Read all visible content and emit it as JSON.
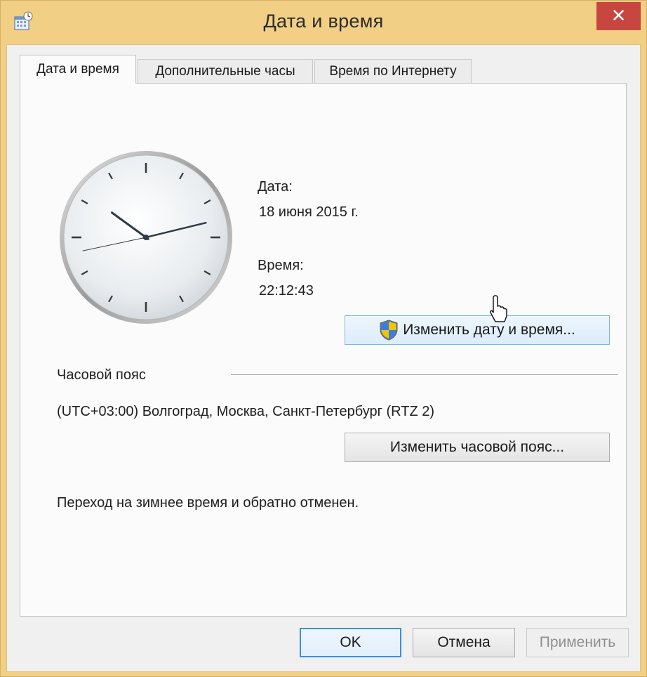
{
  "window": {
    "title": "Дата и время",
    "title_icon": "calendar-clock-icon",
    "close_icon": "close-icon",
    "close_glyph": "✕",
    "close_color": "#c7463f",
    "frame_color": "#f1cf85"
  },
  "tabs": [
    {
      "label": "Дата и время",
      "active": true
    },
    {
      "label": "Дополнительные часы",
      "active": false
    },
    {
      "label": "Время по Интернету",
      "active": false
    }
  ],
  "date_time": {
    "clock_icon": "analog-clock-icon",
    "date_label": "Дата:",
    "date_value": "18 июня 2015 г.",
    "time_label": "Время:",
    "time_value": "22:12:43",
    "change_button": "Изменить дату и время...",
    "change_button_icon": "uac-shield-icon"
  },
  "timezone": {
    "section_label": "Часовой пояс",
    "value": "(UTC+03:00) Волгоград, Москва, Санкт-Петербург (RTZ 2)",
    "change_button": "Изменить часовой пояс..."
  },
  "dst_note": "Переход на зимнее время и обратно отменен.",
  "footer": {
    "ok": "OK",
    "cancel": "Отмена",
    "apply": "Применить"
  },
  "cursor_icon": "mouse-pointer-icon"
}
